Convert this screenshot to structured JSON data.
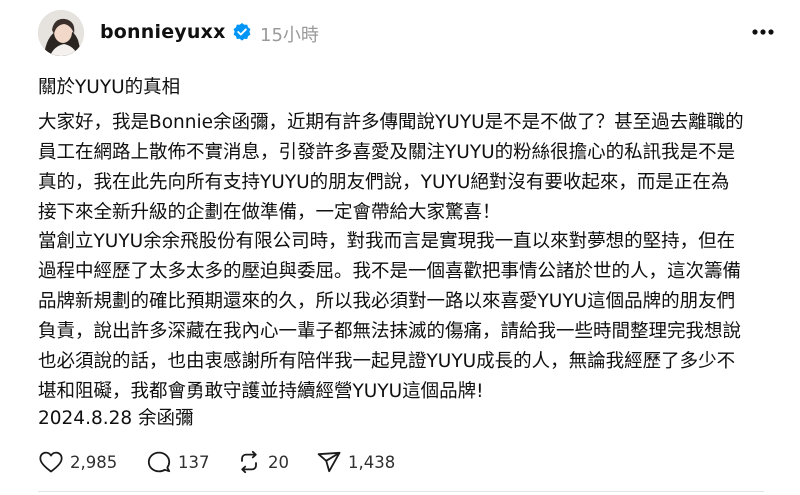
{
  "post": {
    "author": {
      "username": "bonnieyuxx",
      "verified_icon": "verified-badge-icon",
      "timestamp": "15小時"
    },
    "title": "關於YUYU的真相",
    "paragraph1_lines": [
      "大家好，我是Bonnie余函彌，近期有許多傳聞說YUYU是不是不做了？甚至過去離職的",
      "員工在網路上散佈不實消息，引發許多喜愛及關注YUYU的粉絲很擔心的私訊我是不是",
      "真的，我在此先向所有支持YUYU的朋友們說，YUYU絕對沒有要收起來，而是正在為",
      "接下來全新升級的企劃在做準備，一定會帶給大家驚喜！"
    ],
    "paragraph2_lines": [
      "當創立YUYU余余飛股份有限公司時，對我而言是實現我一直以來對夢想的堅持，但在",
      "過程中經歷了太多太多的壓迫與委屈。我不是一個喜歡把事情公諸於世的人，這次籌備",
      "品牌新規劃的確比預期還來的久，所以我必須對一路以來喜愛YUYU這個品牌的朋友們",
      "負責，說出許多深藏在我內心一輩子都無法抹滅的傷痛，請給我一些時間整理完我想說",
      "也必須說的話，也由衷感謝所有陪伴我一起見證YUYU成長的人，無論我經歷了多少不",
      "堪和阻礙，我都會勇敢守護並持續經營YUYU這個品牌!"
    ],
    "signature": "2024.8.28 余函彌",
    "stats": {
      "likes": "2,985",
      "replies": "137",
      "reposts": "20",
      "shares": "1,438"
    }
  },
  "colors": {
    "text": "#101010",
    "muted": "#9a9a9a",
    "verified": "#0095f6",
    "divider": "#e2e2e2"
  }
}
